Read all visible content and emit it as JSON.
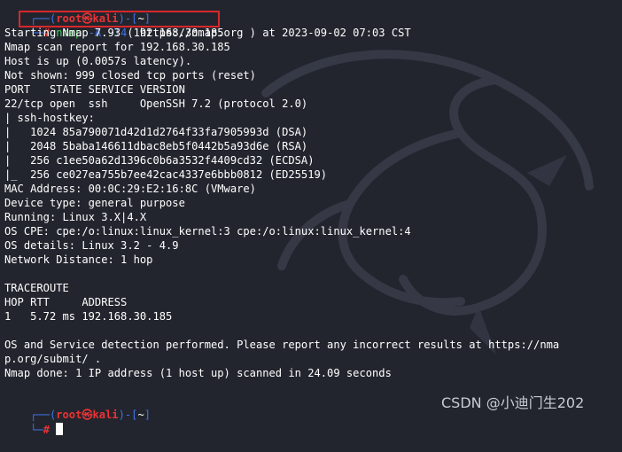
{
  "prompt_top": {
    "corner": "┌──",
    "open_paren": "(",
    "user_host": "root㉿kali",
    "close_paren": ")-[",
    "path": "~",
    "close_bracket": "]",
    "branch": "└─",
    "symbol": "#"
  },
  "command": {
    "program": "nmap",
    "flag1": "-A",
    "flag2": "-T4",
    "target": "192.168.30.185"
  },
  "output_lines": [
    "Starting Nmap 7.93 ( https://nmap.org ) at 2023-09-02 07:03 CST",
    "Nmap scan report for 192.168.30.185",
    "Host is up (0.0057s latency).",
    "Not shown: 999 closed tcp ports (reset)",
    "PORT   STATE SERVICE VERSION",
    "22/tcp open  ssh     OpenSSH 7.2 (protocol 2.0)",
    "| ssh-hostkey:",
    "|   1024 85a790071d42d1d2764f33fa7905993d (DSA)",
    "|   2048 5baba146611dbac8eb5f0442b5a93d6e (RSA)",
    "|   256 c1ee50a62d1396c0b6a3532f4409cd32 (ECDSA)",
    "|_  256 ce027ea755b7ee42cac4337e6bbb0812 (ED25519)",
    "MAC Address: 00:0C:29:E2:16:8C (VMware)",
    "Device type: general purpose",
    "Running: Linux 3.X|4.X",
    "OS CPE: cpe:/o:linux:linux_kernel:3 cpe:/o:linux:linux_kernel:4",
    "OS details: Linux 3.2 - 4.9",
    "Network Distance: 1 hop",
    "",
    "TRACEROUTE",
    "HOP RTT     ADDRESS",
    "1   5.72 ms 192.168.30.185",
    "",
    "OS and Service detection performed. Please report any incorrect results at https://nma",
    "p.org/submit/ .",
    "Nmap done: 1 IP address (1 host up) scanned in 24.09 seconds"
  ],
  "watermark": "CSDN @小迪门生202",
  "colors": {
    "background": "#23252e",
    "prompt_blue": "#3f74e6",
    "prompt_red": "#ea3334",
    "command_green": "#49cf5f",
    "highlight_box": "#d7282b"
  },
  "icons": {
    "background_logo": "kali-dragon-icon",
    "cursor": "block-cursor"
  }
}
